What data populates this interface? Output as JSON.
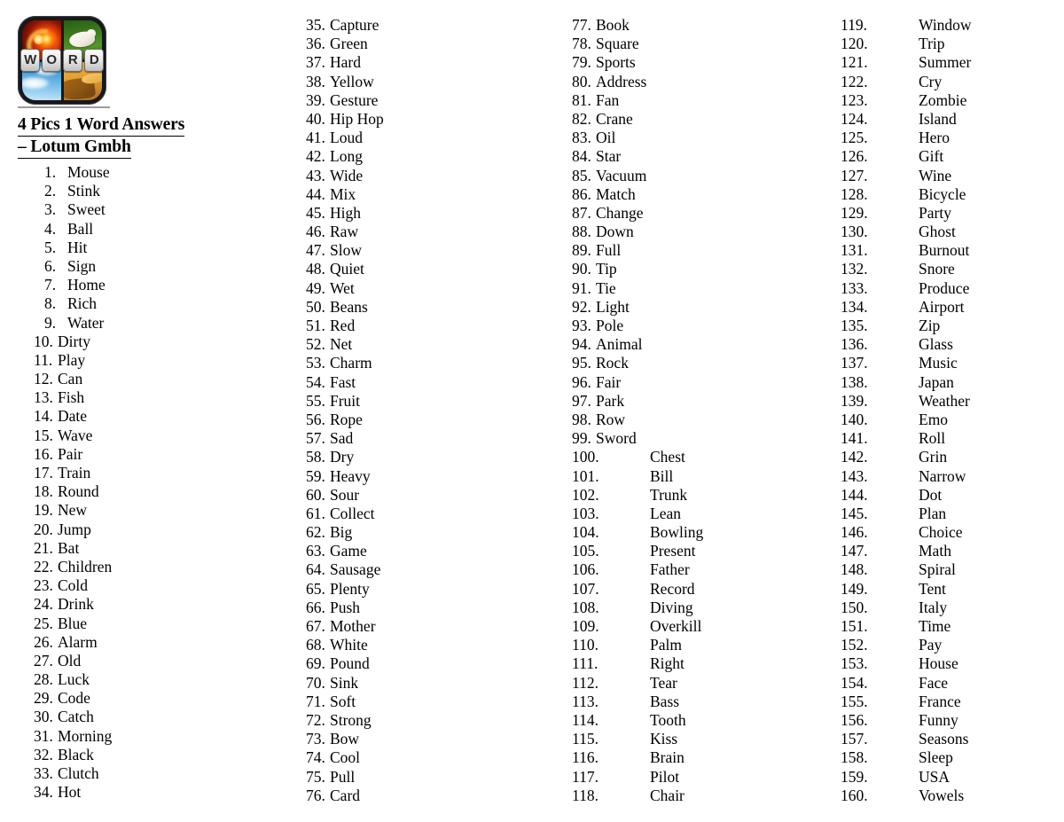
{
  "header": {
    "logo": {
      "icon_name": "4-pics-1-word-app-icon",
      "quadrants": [
        "fire-image",
        "dog-on-grass-image",
        "blue-sky-clouds-image",
        "desert-dune-image"
      ],
      "tiles": [
        "W",
        "O",
        "R",
        "D"
      ]
    },
    "title_line_1": "4 Pics 1 Word Answers",
    "title_line_2": "– Lotum Gmbh"
  },
  "colors": {
    "text": "#000000",
    "page_background": "#ffffff",
    "logo_frame": "#17181c",
    "link_underline": "#9a9a9a",
    "fire_accent": "#ff8a0d",
    "grass_accent": "#3e7d1d",
    "sky_accent": "#55a6dd",
    "desert_accent": "#e1a033"
  },
  "answers": [
    {
      "n": "1.",
      "word": "Mouse"
    },
    {
      "n": "2.",
      "word": "Stink"
    },
    {
      "n": "3.",
      "word": "Sweet"
    },
    {
      "n": "4.",
      "word": "Ball"
    },
    {
      "n": "5.",
      "word": "Hit"
    },
    {
      "n": "6.",
      "word": "Sign"
    },
    {
      "n": "7.",
      "word": "Home"
    },
    {
      "n": "8.",
      "word": "Rich"
    },
    {
      "n": "9.",
      "word": "Water"
    },
    {
      "n": "10.",
      "word": "Dirty"
    },
    {
      "n": "11.",
      "word": "Play"
    },
    {
      "n": "12.",
      "word": "Can"
    },
    {
      "n": "13.",
      "word": "Fish"
    },
    {
      "n": "14.",
      "word": "Date"
    },
    {
      "n": "15.",
      "word": "Wave"
    },
    {
      "n": "16.",
      "word": "Pair"
    },
    {
      "n": "17.",
      "word": "Train"
    },
    {
      "n": "18.",
      "word": "Round"
    },
    {
      "n": "19.",
      "word": "New"
    },
    {
      "n": "20.",
      "word": "Jump"
    },
    {
      "n": "21.",
      "word": "Bat"
    },
    {
      "n": "22.",
      "word": "Children"
    },
    {
      "n": "23.",
      "word": "Cold"
    },
    {
      "n": "24.",
      "word": "Drink"
    },
    {
      "n": "25.",
      "word": "Blue"
    },
    {
      "n": "26.",
      "word": "Alarm"
    },
    {
      "n": "27.",
      "word": "Old"
    },
    {
      "n": "28.",
      "word": "Luck"
    },
    {
      "n": "29.",
      "word": "Code"
    },
    {
      "n": "30.",
      "word": "Catch"
    },
    {
      "n": "31.",
      "word": "Morning"
    },
    {
      "n": "32.",
      "word": "Black"
    },
    {
      "n": "33.",
      "word": "Clutch"
    },
    {
      "n": "34.",
      "word": "Hot"
    },
    {
      "n": "35.",
      "word": "Capture"
    },
    {
      "n": "36.",
      "word": "Green"
    },
    {
      "n": "37.",
      "word": "Hard"
    },
    {
      "n": "38.",
      "word": "Yellow"
    },
    {
      "n": "39.",
      "word": "Gesture"
    },
    {
      "n": "40.",
      "word": "Hip Hop"
    },
    {
      "n": "41.",
      "word": "Loud"
    },
    {
      "n": "42.",
      "word": "Long"
    },
    {
      "n": "43.",
      "word": "Wide"
    },
    {
      "n": "44.",
      "word": "Mix"
    },
    {
      "n": "45.",
      "word": "High"
    },
    {
      "n": "46.",
      "word": "Raw"
    },
    {
      "n": "47.",
      "word": "Slow"
    },
    {
      "n": "48.",
      "word": "Quiet"
    },
    {
      "n": "49.",
      "word": "Wet"
    },
    {
      "n": "50.",
      "word": "Beans"
    },
    {
      "n": "51.",
      "word": "Red"
    },
    {
      "n": "52.",
      "word": "Net"
    },
    {
      "n": "53.",
      "word": "Charm"
    },
    {
      "n": "54.",
      "word": "Fast"
    },
    {
      "n": "55.",
      "word": "Fruit"
    },
    {
      "n": "56.",
      "word": "Rope"
    },
    {
      "n": "57.",
      "word": "Sad"
    },
    {
      "n": "58.",
      "word": "Dry"
    },
    {
      "n": "59.",
      "word": "Heavy"
    },
    {
      "n": "60.",
      "word": "Sour"
    },
    {
      "n": "61.",
      "word": "Collect"
    },
    {
      "n": "62.",
      "word": "Big"
    },
    {
      "n": "63.",
      "word": "Game"
    },
    {
      "n": "64.",
      "word": "Sausage"
    },
    {
      "n": "65.",
      "word": "Plenty"
    },
    {
      "n": "66.",
      "word": "Push"
    },
    {
      "n": "67.",
      "word": "Mother"
    },
    {
      "n": "68.",
      "word": "White"
    },
    {
      "n": "69.",
      "word": "Pound"
    },
    {
      "n": "70.",
      "word": "Sink"
    },
    {
      "n": "71.",
      "word": "Soft"
    },
    {
      "n": "72.",
      "word": "Strong"
    },
    {
      "n": "73.",
      "word": "Bow"
    },
    {
      "n": "74.",
      "word": "Cool"
    },
    {
      "n": "75.",
      "word": "Pull"
    },
    {
      "n": "76.",
      "word": "Card"
    },
    {
      "n": "77.",
      "word": "Book"
    },
    {
      "n": "78.",
      "word": "Square"
    },
    {
      "n": "79.",
      "word": "Sports"
    },
    {
      "n": "80.",
      "word": "Address"
    },
    {
      "n": "81.",
      "word": "Fan"
    },
    {
      "n": "82.",
      "word": "Crane"
    },
    {
      "n": "83.",
      "word": "Oil"
    },
    {
      "n": "84.",
      "word": "Star"
    },
    {
      "n": "85.",
      "word": "Vacuum"
    },
    {
      "n": "86.",
      "word": "Match"
    },
    {
      "n": "87.",
      "word": "Change"
    },
    {
      "n": "88.",
      "word": "Down"
    },
    {
      "n": "89.",
      "word": "Full"
    },
    {
      "n": "90.",
      "word": "Tip"
    },
    {
      "n": "91.",
      "word": "Tie"
    },
    {
      "n": "92.",
      "word": "Light"
    },
    {
      "n": "93.",
      "word": "Pole"
    },
    {
      "n": "94.",
      "word": "Animal"
    },
    {
      "n": "95.",
      "word": "Rock"
    },
    {
      "n": "96.",
      "word": "Fair"
    },
    {
      "n": "97.",
      "word": "Park"
    },
    {
      "n": "98.",
      "word": "Row"
    },
    {
      "n": "99.",
      "word": "Sword"
    },
    {
      "n": "100.",
      "word": "Chest"
    },
    {
      "n": "101.",
      "word": "Bill"
    },
    {
      "n": "102.",
      "word": "Trunk"
    },
    {
      "n": "103.",
      "word": "Lean"
    },
    {
      "n": "104.",
      "word": "Bowling"
    },
    {
      "n": "105.",
      "word": "Present"
    },
    {
      "n": "106.",
      "word": "Father"
    },
    {
      "n": "107.",
      "word": "Record"
    },
    {
      "n": "108.",
      "word": "Diving"
    },
    {
      "n": "109.",
      "word": "Overkill"
    },
    {
      "n": "110.",
      "word": "Palm"
    },
    {
      "n": "111.",
      "word": "Right"
    },
    {
      "n": "112.",
      "word": "Tear"
    },
    {
      "n": "113.",
      "word": "Bass"
    },
    {
      "n": "114.",
      "word": "Tooth"
    },
    {
      "n": "115.",
      "word": "Kiss"
    },
    {
      "n": "116.",
      "word": "Brain"
    },
    {
      "n": "117.",
      "word": "Pilot"
    },
    {
      "n": "118.",
      "word": "Chair"
    },
    {
      "n": "119.",
      "word": "Window"
    },
    {
      "n": "120.",
      "word": "Trip"
    },
    {
      "n": "121.",
      "word": "Summer"
    },
    {
      "n": "122.",
      "word": "Cry"
    },
    {
      "n": "123.",
      "word": "Zombie"
    },
    {
      "n": "124.",
      "word": "Island"
    },
    {
      "n": "125.",
      "word": "Hero"
    },
    {
      "n": "126.",
      "word": "Gift"
    },
    {
      "n": "127.",
      "word": "Wine"
    },
    {
      "n": "128.",
      "word": "Bicycle"
    },
    {
      "n": "129.",
      "word": "Party"
    },
    {
      "n": "130.",
      "word": "Ghost"
    },
    {
      "n": "131.",
      "word": "Burnout"
    },
    {
      "n": "132.",
      "word": "Snore"
    },
    {
      "n": "133.",
      "word": "Produce"
    },
    {
      "n": "134.",
      "word": "Airport"
    },
    {
      "n": "135.",
      "word": "Zip"
    },
    {
      "n": "136.",
      "word": "Glass"
    },
    {
      "n": "137.",
      "word": "Music"
    },
    {
      "n": "138.",
      "word": "Japan"
    },
    {
      "n": "139.",
      "word": "Weather"
    },
    {
      "n": "140.",
      "word": "Emo"
    },
    {
      "n": "141.",
      "word": "Roll"
    },
    {
      "n": "142.",
      "word": "Grin"
    },
    {
      "n": "143.",
      "word": "Narrow"
    },
    {
      "n": "144.",
      "word": "Dot"
    },
    {
      "n": "145.",
      "word": "Plan"
    },
    {
      "n": "146.",
      "word": "Choice"
    },
    {
      "n": "147.",
      "word": "Math"
    },
    {
      "n": "148.",
      "word": "Spiral"
    },
    {
      "n": "149.",
      "word": "Tent"
    },
    {
      "n": "150.",
      "word": "Italy"
    },
    {
      "n": "151.",
      "word": "Time"
    },
    {
      "n": "152.",
      "word": "Pay"
    },
    {
      "n": "153.",
      "word": "House"
    },
    {
      "n": "154.",
      "word": "Face"
    },
    {
      "n": "155.",
      "word": "France"
    },
    {
      "n": "156.",
      "word": "Funny"
    },
    {
      "n": "157.",
      "word": "Seasons"
    },
    {
      "n": "158.",
      "word": "Sleep"
    },
    {
      "n": "159.",
      "word": "USA"
    },
    {
      "n": "160.",
      "word": "Vowels"
    }
  ],
  "columns": [
    {
      "id": "col-1",
      "start": 1,
      "end": 34
    },
    {
      "id": "col-2",
      "start": 35,
      "end": 76
    },
    {
      "id": "col-3",
      "start": 77,
      "end": 118
    },
    {
      "id": "col-4",
      "start": 119,
      "end": 160
    }
  ]
}
